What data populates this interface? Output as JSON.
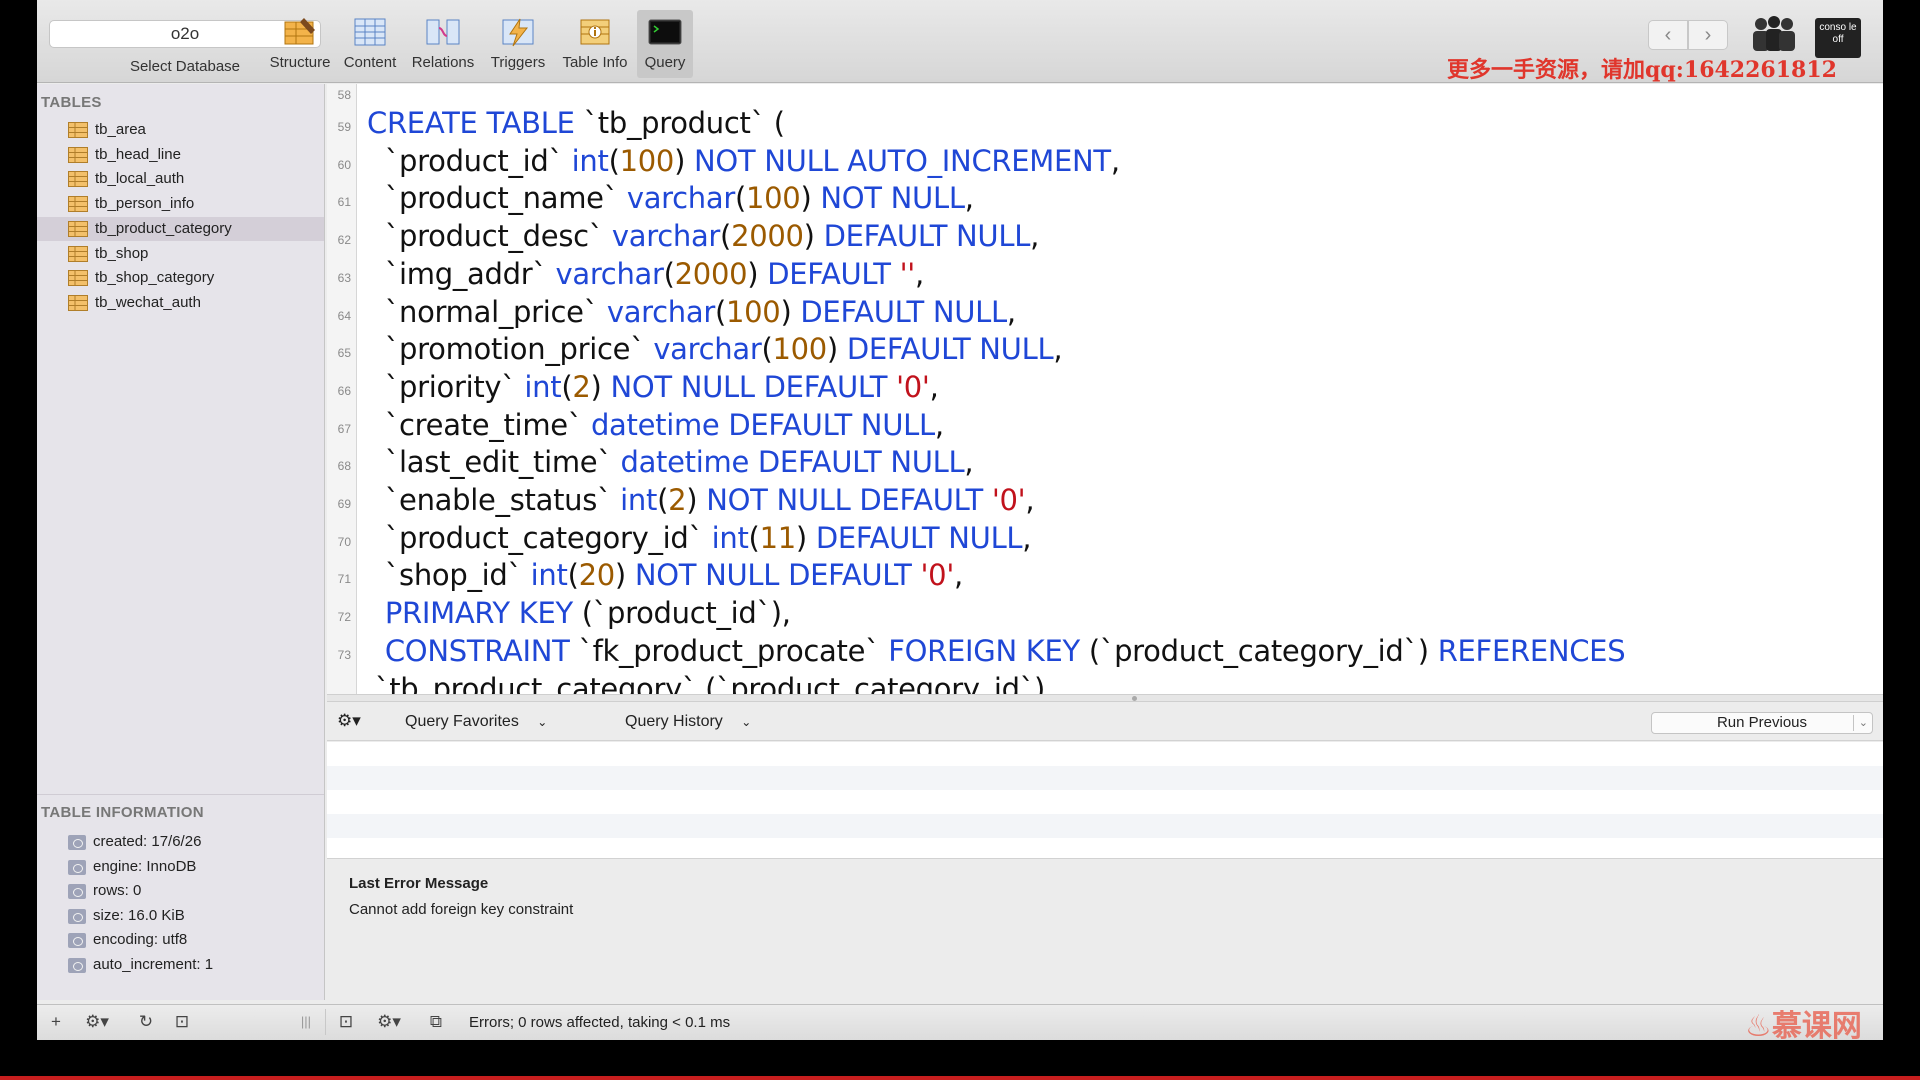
{
  "toolbar": {
    "database": "o2o",
    "select_database_label": "Select Database",
    "tools": [
      {
        "label": "Structure"
      },
      {
        "label": "Content"
      },
      {
        "label": "Relations"
      },
      {
        "label": "Triggers"
      },
      {
        "label": "Table Info"
      },
      {
        "label": "Query"
      }
    ],
    "active_tool": "Query",
    "console_label": "conso le off",
    "back_glyph": "‹",
    "forward_glyph": "›"
  },
  "watermark": "更多一手资源，请加qq:1642261812",
  "sidebar": {
    "tables_header": "TABLES",
    "tables": [
      {
        "name": "tb_area",
        "selected": false
      },
      {
        "name": "tb_head_line",
        "selected": false
      },
      {
        "name": "tb_local_auth",
        "selected": false
      },
      {
        "name": "tb_person_info",
        "selected": false
      },
      {
        "name": "tb_product_category",
        "selected": true
      },
      {
        "name": "tb_shop",
        "selected": false
      },
      {
        "name": "tb_shop_category",
        "selected": false
      },
      {
        "name": "tb_wechat_auth",
        "selected": false
      }
    ],
    "info_header": "TABLE INFORMATION",
    "info": [
      "created: 17/6/26",
      "engine: InnoDB",
      "rows: 0",
      "size: 16.0 KiB",
      "encoding: utf8",
      "auto_increment: 1"
    ]
  },
  "editor": {
    "lines": [
      {
        "n": "58",
        "tokens": []
      },
      {
        "n": "59",
        "tokens": [
          [
            "k",
            "CREATE TABLE "
          ],
          [
            "t",
            "`tb_product`"
          ],
          [
            "t",
            " ("
          ]
        ]
      },
      {
        "n": "60",
        "tokens": [
          [
            "t",
            "  `product_id` "
          ],
          [
            "k",
            "int"
          ],
          [
            "t",
            "("
          ],
          [
            "n",
            "100"
          ],
          [
            "t",
            ") "
          ],
          [
            "k",
            "NOT NULL AUTO_INCREMENT"
          ],
          [
            "t",
            ","
          ]
        ]
      },
      {
        "n": "61",
        "tokens": [
          [
            "t",
            "  `product_name` "
          ],
          [
            "k",
            "varchar"
          ],
          [
            "t",
            "("
          ],
          [
            "n",
            "100"
          ],
          [
            "t",
            ") "
          ],
          [
            "k",
            "NOT NULL"
          ],
          [
            "t",
            ","
          ]
        ]
      },
      {
        "n": "62",
        "tokens": [
          [
            "t",
            "  `product_desc` "
          ],
          [
            "k",
            "varchar"
          ],
          [
            "t",
            "("
          ],
          [
            "n",
            "2000"
          ],
          [
            "t",
            ") "
          ],
          [
            "k",
            "DEFAULT NULL"
          ],
          [
            "t",
            ","
          ]
        ]
      },
      {
        "n": "63",
        "tokens": [
          [
            "t",
            "  `img_addr` "
          ],
          [
            "k",
            "varchar"
          ],
          [
            "t",
            "("
          ],
          [
            "n",
            "2000"
          ],
          [
            "t",
            ") "
          ],
          [
            "k",
            "DEFAULT "
          ],
          [
            "s",
            "''"
          ],
          [
            "t",
            ","
          ]
        ]
      },
      {
        "n": "64",
        "tokens": [
          [
            "t",
            "  `normal_price` "
          ],
          [
            "k",
            "varchar"
          ],
          [
            "t",
            "("
          ],
          [
            "n",
            "100"
          ],
          [
            "t",
            ") "
          ],
          [
            "k",
            "DEFAULT NULL"
          ],
          [
            "t",
            ","
          ]
        ]
      },
      {
        "n": "65",
        "tokens": [
          [
            "t",
            "  `promotion_price` "
          ],
          [
            "k",
            "varchar"
          ],
          [
            "t",
            "("
          ],
          [
            "n",
            "100"
          ],
          [
            "t",
            ") "
          ],
          [
            "k",
            "DEFAULT NULL"
          ],
          [
            "t",
            ","
          ]
        ]
      },
      {
        "n": "66",
        "tokens": [
          [
            "t",
            "  `priority` "
          ],
          [
            "k",
            "int"
          ],
          [
            "t",
            "("
          ],
          [
            "n",
            "2"
          ],
          [
            "t",
            ") "
          ],
          [
            "k",
            "NOT NULL DEFAULT "
          ],
          [
            "s",
            "'0'"
          ],
          [
            "t",
            ","
          ]
        ]
      },
      {
        "n": "67",
        "tokens": [
          [
            "t",
            "  `create_time` "
          ],
          [
            "k",
            "datetime DEFAULT NULL"
          ],
          [
            "t",
            ","
          ]
        ]
      },
      {
        "n": "68",
        "tokens": [
          [
            "t",
            "  `last_edit_time` "
          ],
          [
            "k",
            "datetime DEFAULT NULL"
          ],
          [
            "t",
            ","
          ]
        ]
      },
      {
        "n": "69",
        "tokens": [
          [
            "t",
            "  `enable_status` "
          ],
          [
            "k",
            "int"
          ],
          [
            "t",
            "("
          ],
          [
            "n",
            "2"
          ],
          [
            "t",
            ") "
          ],
          [
            "k",
            "NOT NULL DEFAULT "
          ],
          [
            "s",
            "'0'"
          ],
          [
            "t",
            ","
          ]
        ]
      },
      {
        "n": "70",
        "tokens": [
          [
            "t",
            "  `product_category_id` "
          ],
          [
            "k",
            "int"
          ],
          [
            "t",
            "("
          ],
          [
            "n",
            "11"
          ],
          [
            "t",
            ") "
          ],
          [
            "k",
            "DEFAULT NULL"
          ],
          [
            "t",
            ","
          ]
        ]
      },
      {
        "n": "71",
        "tokens": [
          [
            "t",
            "  `shop_id` "
          ],
          [
            "k",
            "int"
          ],
          [
            "t",
            "("
          ],
          [
            "n",
            "20"
          ],
          [
            "t",
            ") "
          ],
          [
            "k",
            "NOT NULL DEFAULT "
          ],
          [
            "s",
            "'0'"
          ],
          [
            "t",
            ","
          ]
        ]
      },
      {
        "n": "72",
        "tokens": [
          [
            "t",
            "  "
          ],
          [
            "k",
            "PRIMARY KEY "
          ],
          [
            "t",
            "(`product_id`),"
          ]
        ]
      },
      {
        "n": "73",
        "tokens": [
          [
            "t",
            "  "
          ],
          [
            "k",
            "CONSTRAINT "
          ],
          [
            "t",
            "`fk_product_procate` "
          ],
          [
            "k",
            "FOREIGN KEY "
          ],
          [
            "t",
            "(`product_category_id`) "
          ],
          [
            "k",
            "REFERENCES"
          ]
        ]
      },
      {
        "n": "",
        "tokens": [
          [
            "t",
            "`tb_product_category` (`product_category_id`)"
          ]
        ]
      }
    ]
  },
  "query_bar": {
    "favorites": "Query Favorites",
    "history": "Query History",
    "run_previous": "Run Previous"
  },
  "error": {
    "title": "Last Error Message",
    "message": "Cannot add foreign key constraint"
  },
  "status": "Errors; 0 rows affected, taking < 0.1 ms",
  "brand_logo": "慕课网",
  "colors": {
    "keyword": "#1f47d6",
    "number": "#9b5a00",
    "string": "#c1121c",
    "watermark": "#e0362c",
    "selected_row": "#d4cfd8"
  }
}
